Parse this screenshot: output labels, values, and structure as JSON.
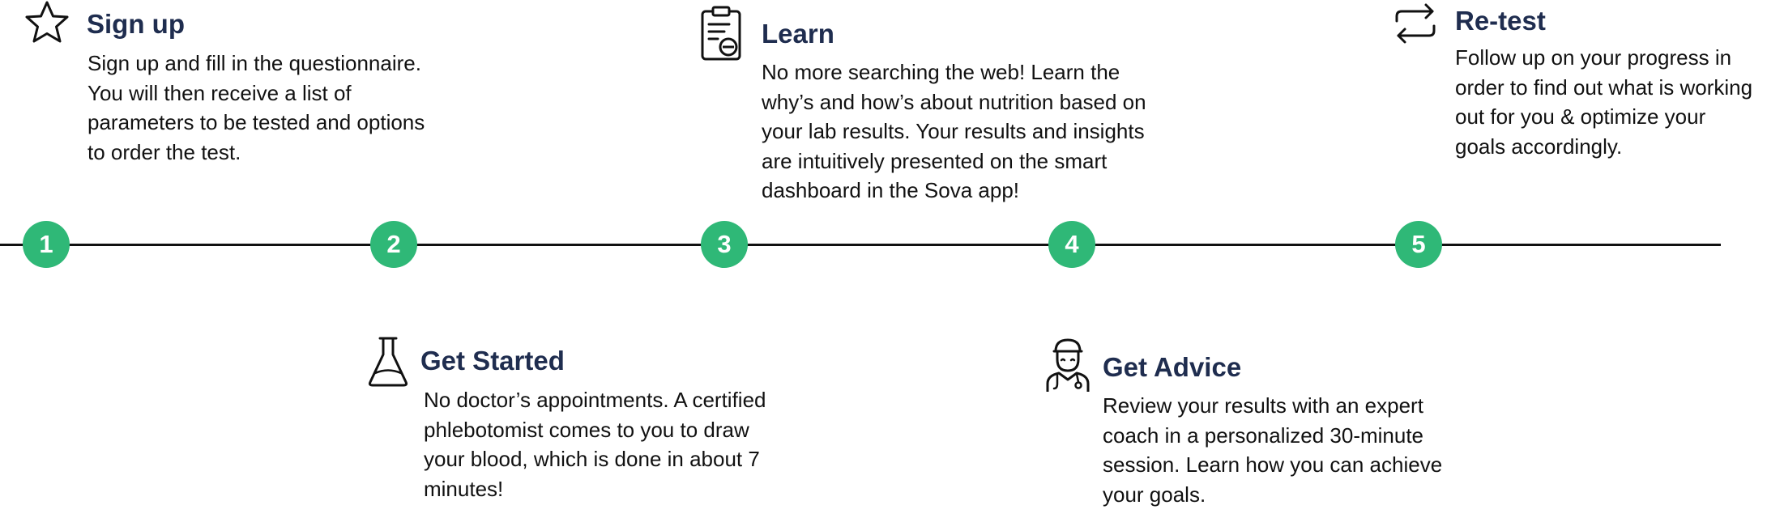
{
  "colors": {
    "node": "#2fb877",
    "title": "#1f2d4f",
    "text": "#111111",
    "line": "#111111"
  },
  "timeline": {
    "nodes": [
      "1",
      "2",
      "3",
      "4",
      "5"
    ]
  },
  "steps": [
    {
      "icon": "star-icon",
      "title": "Sign up",
      "description": [
        "Sign up and fill in the questionnaire.",
        "You will then receive a list of",
        "parameters to be tested and options",
        "to order the test."
      ]
    },
    {
      "icon": "flask-icon",
      "title": "Get Started",
      "description": [
        "No doctor’s appointments. A certified",
        "phlebotomist comes to you to draw",
        "your blood, which is done in about 7",
        "minutes!"
      ]
    },
    {
      "icon": "clipboard-report-icon",
      "title": "Learn",
      "description": [
        "No more searching the web! Learn the",
        "why’s and how’s about nutrition based on",
        "your lab results. Your results and insights",
        "are intuitively presented on the smart",
        "dashboard in the Sova app!"
      ]
    },
    {
      "icon": "doctor-icon",
      "title": "Get Advice",
      "description": [
        "Review your results with an expert",
        "coach in a personalized 30-minute",
        "session. Learn how you can achieve",
        "your goals."
      ]
    },
    {
      "icon": "repeat-arrows-icon",
      "title": "Re-test",
      "description": [
        "Follow up on your progress in",
        "order to find out what is working",
        "out for you & optimize your",
        "goals accordingly."
      ]
    }
  ]
}
